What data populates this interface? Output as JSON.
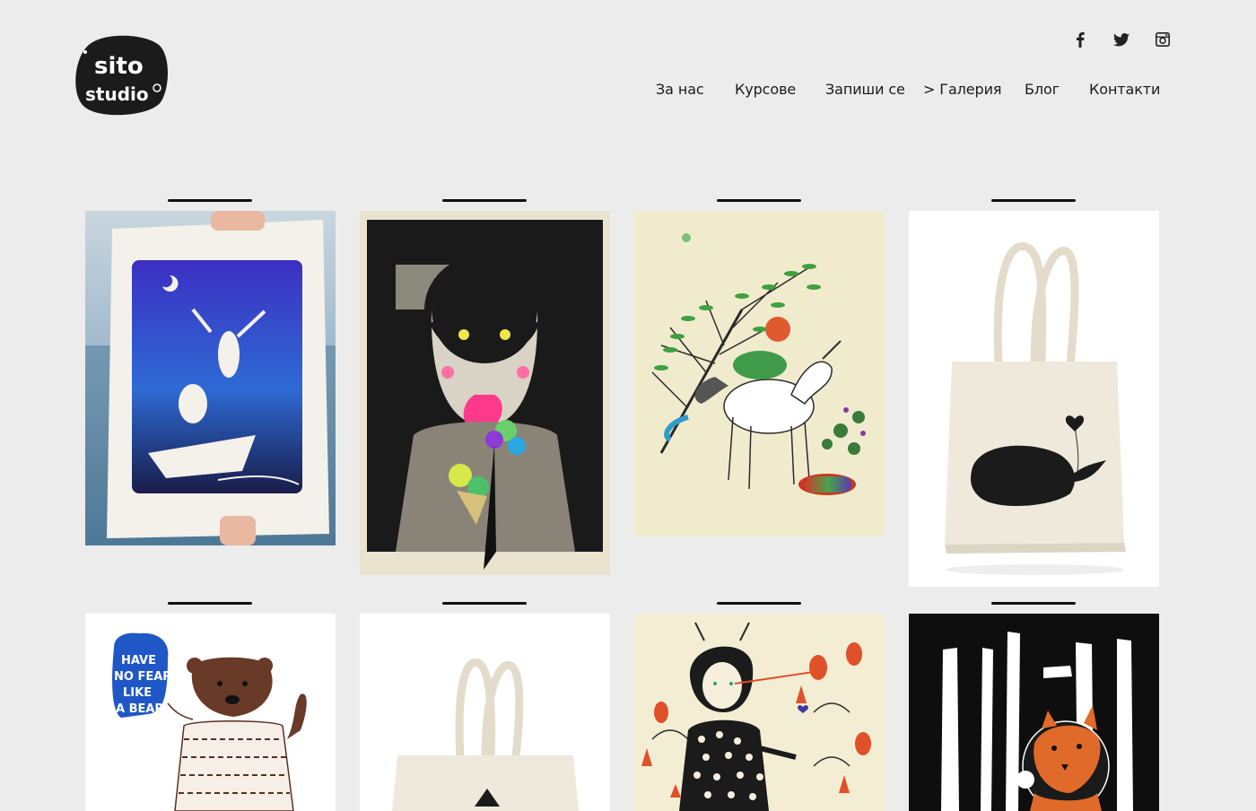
{
  "site": {
    "logo_text_top": "sito",
    "logo_text_bottom": "studio",
    "logo_icon": "sito-studio-logo"
  },
  "social": [
    {
      "name": "facebook",
      "icon": "facebook-icon",
      "glyph": "f"
    },
    {
      "name": "twitter",
      "icon": "twitter-icon"
    },
    {
      "name": "instagram",
      "icon": "instagram-icon"
    }
  ],
  "nav": {
    "items": [
      {
        "label": "За нас"
      },
      {
        "label": "Курсове"
      },
      {
        "label": "Запиши се"
      },
      {
        "label": "> Галерия",
        "active": true
      },
      {
        "label": "Блог"
      },
      {
        "label": "Контакти"
      }
    ]
  },
  "gallery": {
    "items": [
      {
        "name": "print-boat-night-sea"
      },
      {
        "name": "print-masked-boy-ice-cream"
      },
      {
        "name": "print-unicorn-hug"
      },
      {
        "name": "tote-bag-whale"
      },
      {
        "name": "print-have-no-fear-bear",
        "text_lines": [
          "HAVE",
          "NO FEAR",
          "LIKE",
          "A BEAR"
        ]
      },
      {
        "name": "tote-bag-plain"
      },
      {
        "name": "print-girl-polka-dots"
      },
      {
        "name": "print-fox-forest"
      }
    ]
  },
  "colors": {
    "background": "#ececec",
    "text": "#1a1a1a",
    "logo_bg": "#1b1b1b"
  }
}
